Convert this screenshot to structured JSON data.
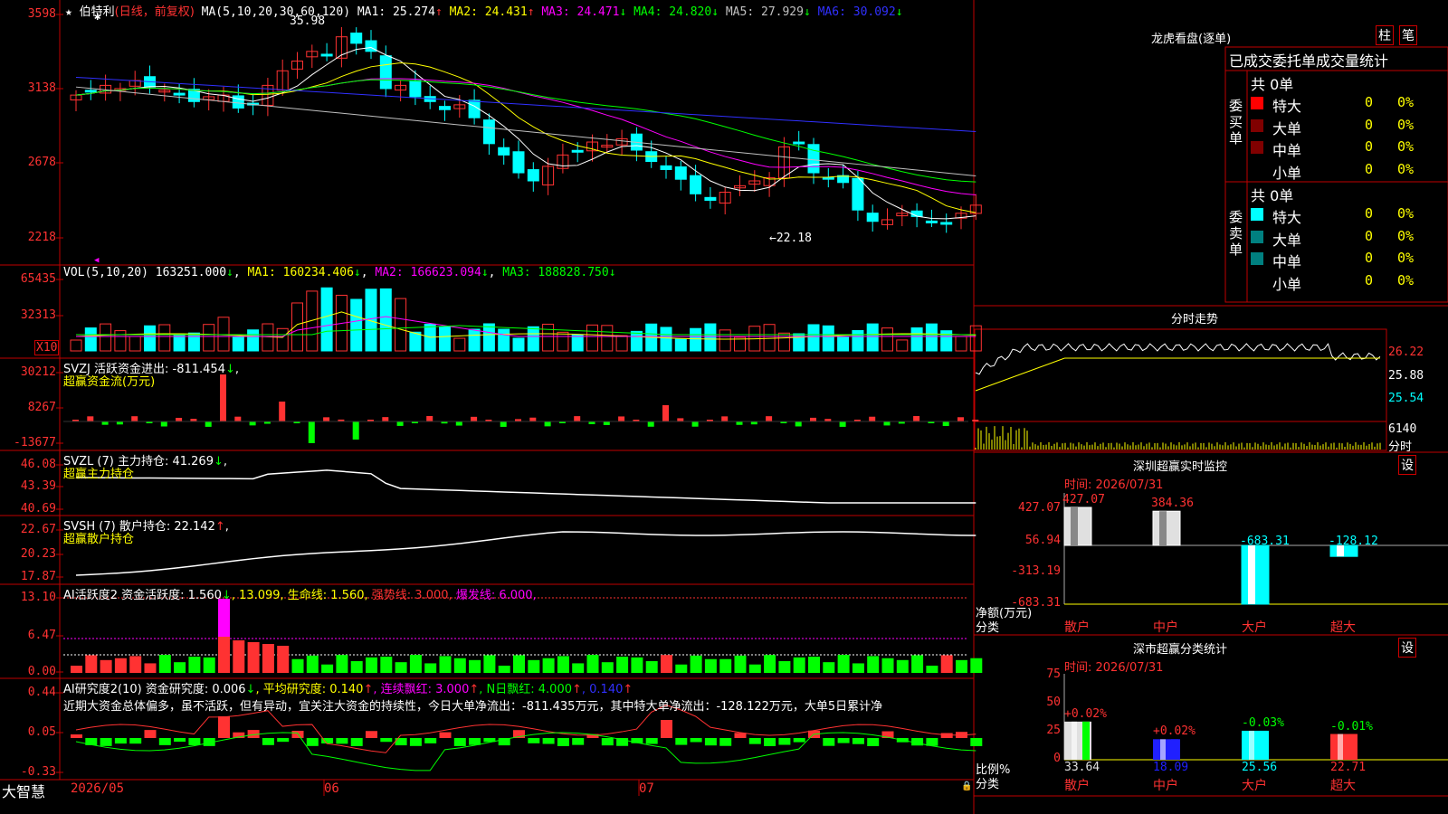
{
  "main": {
    "stock_name": "伯特利",
    "period": "(日线，前复权)",
    "ma_label": "MA(5,10,20,30,60,120)",
    "ma_values": [
      {
        "label": "MA1:",
        "value": "25.274",
        "dir": "↑",
        "color": "#ffffff"
      },
      {
        "label": "MA2:",
        "value": "24.431",
        "dir": "↑",
        "color": "#ffff00"
      },
      {
        "label": "MA3:",
        "value": "24.471",
        "dir": "↓",
        "color": "#ff00ff"
      },
      {
        "label": "MA4:",
        "value": "24.820",
        "dir": "↓",
        "color": "#00ff00"
      },
      {
        "label": "MA5:",
        "value": "27.929",
        "dir": "↓",
        "color": "#c0c0c0"
      },
      {
        "label": "MA6:",
        "value": "30.092",
        "dir": "↓",
        "color": "#3030ff"
      }
    ],
    "y_labels": [
      "3598",
      "3138",
      "2678",
      "2218"
    ],
    "high_label": "35.98",
    "low_label": "←22.18"
  },
  "vol": {
    "label": "VOL(5,10,20)",
    "value": "163251.000",
    "dir": "↓",
    "ma1": "MA1: 160234.406",
    "ma1_dir": "↓",
    "ma2": "MA2: 166623.094",
    "ma2_dir": "↓",
    "ma3": "MA3: 188828.750",
    "ma3_dir": "↓",
    "y_labels": [
      "65435",
      "32313"
    ],
    "unit": "X10"
  },
  "svzj": {
    "label": "SVZJ  活跃资金进出: -811.454",
    "dir": "↓",
    "comma": ",",
    "sub": "超赢资金流(万元)",
    "y_labels": [
      "30212",
      "8267",
      "-13677"
    ]
  },
  "svzl": {
    "label": "SVZL (7) 主力持仓: 41.269",
    "dir": "↓",
    "comma": ",",
    "sub": "超赢主力持仓",
    "y_labels": [
      "46.08",
      "43.39",
      "40.69"
    ]
  },
  "svsh": {
    "label": "SVSH (7) 散户持仓: 22.142",
    "dir": "↑",
    "comma": ",",
    "sub": "超赢散户持仓",
    "y_labels": [
      "22.67",
      "20.23",
      "17.87"
    ]
  },
  "ai1": {
    "p1": "AI活跃度2 资金活跃度: 1.560",
    "p1_dir": "↓",
    "p2": ", 13.099, 生命线: 1.560,",
    "p3": "强势线: 3.000,",
    "p4": "爆发线: 6.000,",
    "y_labels": [
      "13.10",
      "6.47",
      "0.00"
    ]
  },
  "ai2": {
    "p1": "AI研究度2(10) 资金研究度: 0.006",
    "p1_dir": "↓",
    "p2": ", 平均研究度: 0.140",
    "p2_dir": "↑",
    "p3": ", 连续飘红: 3.000",
    "p3_dir": "↑",
    "p4": ", N日飘红: 4.000",
    "p4_dir": "↑",
    "p5": ", 0.140",
    "p5_dir": "↑",
    "text": "近期大资金总体偏多，虽不活跃，但有异动，宜关注大资金的持续性，今日大单净流出：-811.435万元，其中特大单净流出：-128.122万元，大单5日累计净",
    "y_labels": [
      "0.44",
      "0.05",
      "-0.33"
    ]
  },
  "bottom": {
    "logo": "大智慧",
    "dates": [
      "2026/05",
      "06",
      "07"
    ]
  },
  "lhb": {
    "title": "龙虎看盘(逐单)",
    "btn1": "柱",
    "btn2": "笔",
    "header": "已成交委托单成交量统计",
    "buy": {
      "side": "委\n买\n单",
      "total": "共 0单",
      "rows": [
        {
          "name": "特大",
          "val": "0",
          "pct": "0%",
          "color": "#ff0000"
        },
        {
          "name": "大单",
          "val": "0",
          "pct": "0%",
          "color": "#800000"
        },
        {
          "name": "中单",
          "val": "0",
          "pct": "0%",
          "color": "#800000"
        },
        {
          "name": "小单",
          "val": "0",
          "pct": "0%",
          "color": "#000000"
        }
      ]
    },
    "sell": {
      "side": "委\n卖\n单",
      "total": "共 0单",
      "rows": [
        {
          "name": "特大",
          "val": "0",
          "pct": "0%",
          "color": "#00ffff"
        },
        {
          "name": "大单",
          "val": "0",
          "pct": "0%",
          "color": "#008080"
        },
        {
          "name": "中单",
          "val": "0",
          "pct": "0%",
          "color": "#008080"
        },
        {
          "name": "小单",
          "val": "0",
          "pct": "0%",
          "color": "#000000"
        }
      ]
    }
  },
  "intraday": {
    "title": "分时走势",
    "y_labels": [
      "26.22",
      "25.88",
      "25.54"
    ],
    "vol_label": "6140",
    "unit": "分时"
  },
  "monitor": {
    "title": "深圳超赢实时监控",
    "btn": "设",
    "time": "时间: 2026/07/31",
    "y_labels": [
      "427.07",
      "56.94",
      "-313.19",
      "-683.31"
    ],
    "ylabel1": "净额(万元)",
    "ylabel2": "分类",
    "bars": [
      {
        "cat": "散户",
        "value": 427.07,
        "label": "427.07"
      },
      {
        "cat": "中户",
        "value": 384.36,
        "label": "384.36"
      },
      {
        "cat": "大户",
        "value": -683.31,
        "label": "-683.31"
      },
      {
        "cat": "超大",
        "value": -128.12,
        "label": "-128.12"
      }
    ]
  },
  "stats": {
    "title": "深市超赢分类统计",
    "btn": "设",
    "time": "时间: 2026/07/31",
    "y_labels": [
      "75",
      "50",
      "25",
      "0"
    ],
    "ylabel1": "比例%",
    "ylabel2": "分类",
    "bars": [
      {
        "cat": "散户",
        "value": 33.64,
        "label": "33.64",
        "chg": "+0.02%"
      },
      {
        "cat": "中户",
        "value": 18.09,
        "label": "18.09",
        "chg": "+0.02%"
      },
      {
        "cat": "大户",
        "value": 25.56,
        "label": "25.56",
        "chg": "-0.03%"
      },
      {
        "cat": "超大",
        "value": 22.71,
        "label": "22.71",
        "chg": "-0.01%"
      }
    ]
  },
  "colors": {
    "up": "#ff3232",
    "down": "#00ffff",
    "grid": "#c00000",
    "label_red": "#ff3232",
    "label_yellow": "#ffff00",
    "label_green": "#00ff00",
    "label_magenta": "#ff00ff"
  }
}
